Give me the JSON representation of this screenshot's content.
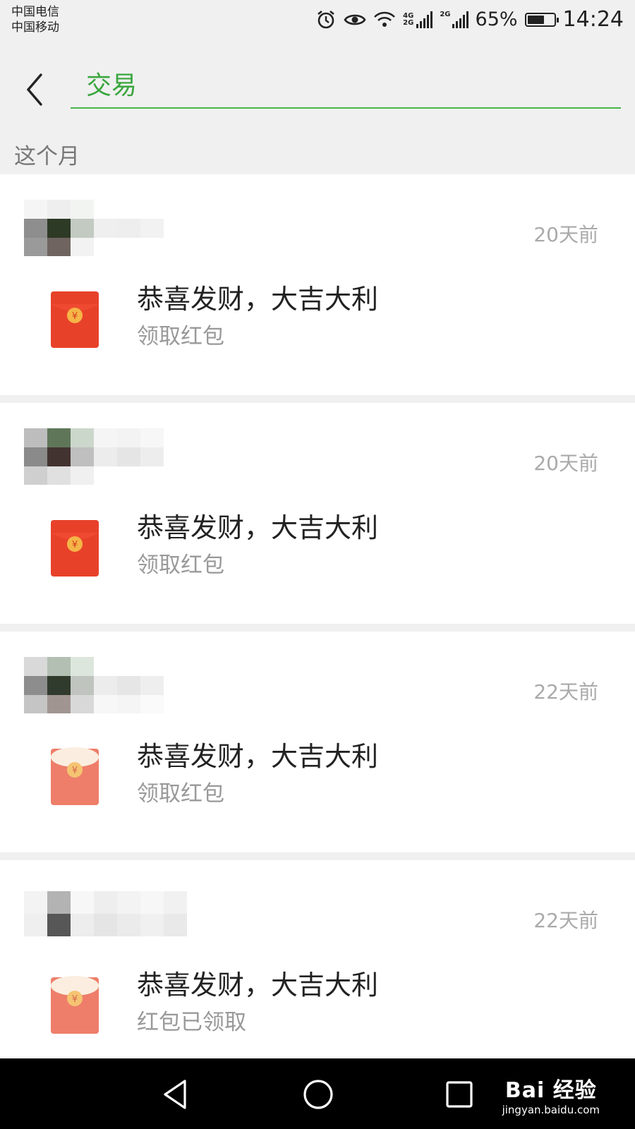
{
  "status_bar": {
    "carrier_1": "中国电信",
    "carrier_2": "中国移动",
    "network_1": "4G",
    "network_2": "2G",
    "network_3": "2G",
    "battery_percent": "65%",
    "time": "14:24",
    "battery_level": 0.65
  },
  "search": {
    "query": "交易"
  },
  "section": {
    "label": "这个月"
  },
  "transactions": [
    {
      "time": "20天前",
      "title": "恭喜发财，大吉大利",
      "status": "领取红包",
      "envelope_state": "unopened"
    },
    {
      "time": "20天前",
      "title": "恭喜发财，大吉大利",
      "status": "领取红包",
      "envelope_state": "unopened"
    },
    {
      "time": "22天前",
      "title": "恭喜发财，大吉大利",
      "status": "领取红包",
      "envelope_state": "opened"
    },
    {
      "time": "22天前",
      "title": "恭喜发财，大吉大利",
      "status": "红包已领取",
      "envelope_state": "opened"
    }
  ],
  "watermark": {
    "brand": "Bai 经验",
    "url": "jingyan.baidu.com"
  },
  "colors": {
    "accent_green": "#45b649",
    "envelope_red": "#e8412a",
    "envelope_opened": "#ee7e6a"
  }
}
